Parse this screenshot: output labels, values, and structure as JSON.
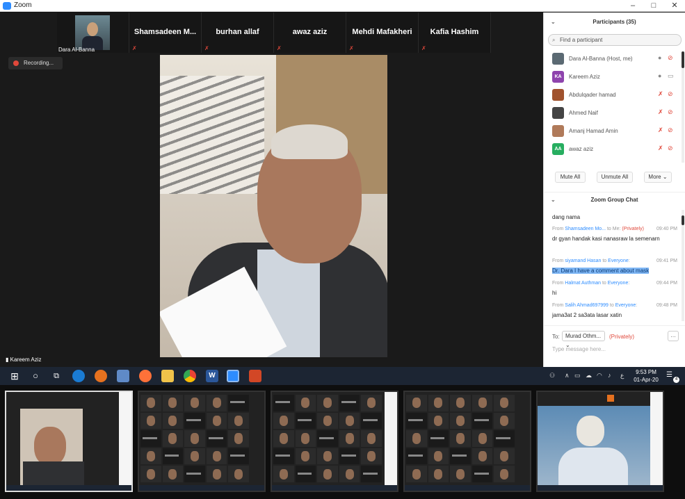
{
  "window": {
    "title": "Zoom",
    "minimize": "–",
    "maximize": "□",
    "close": "✕"
  },
  "strip": {
    "tiles": [
      {
        "label": "Dara Al-Banna",
        "photo": true
      },
      {
        "label": "Shamsadeen  M..."
      },
      {
        "label": "burhan allaf"
      },
      {
        "label": "awaz aziz"
      },
      {
        "label": "Mehdi Mafakheri"
      },
      {
        "label": "Kafia Hashim"
      }
    ],
    "next_glyph": "›"
  },
  "recording": {
    "label": "Recording..."
  },
  "speaker": {
    "name": "Kareem Aziz"
  },
  "panel": {
    "title": "Participants (35)",
    "search_placeholder": "Find a participant",
    "participants": [
      {
        "name": "Dara Al-Banna (Host, me)",
        "avatar_color": "#5b6a73",
        "initials": ""
      },
      {
        "name": "Kareem Aziz",
        "avatar_color": "#8e44ad",
        "initials": "KA"
      },
      {
        "name": "Abdulqader hamad",
        "avatar_color": "#a0522d",
        "initials": ""
      },
      {
        "name": "Ahmed Naif",
        "avatar_color": "#444",
        "initials": ""
      },
      {
        "name": "Amanj Hamad Amin",
        "avatar_color": "#b07a5a",
        "initials": ""
      },
      {
        "name": "awaz aziz",
        "avatar_color": "#27ae60",
        "initials": "AA"
      }
    ],
    "mute_all": "Mute All",
    "unmute_all": "Unmute All",
    "more": "More",
    "chat_title": "Zoom Group Chat",
    "messages": [
      {
        "text": "dang nama"
      },
      {
        "from": "Shamsadeen Mo...",
        "to": "Me",
        "privacy": "(Privately)",
        "time": "09:40 PM",
        "text": "dr gyan handak kasi nanasraw la semenarn"
      },
      {
        "from": "siyamand Hasan",
        "to": "Everyone",
        "time": "09:41 PM",
        "text": "Dr. Dara I have a comment about mask",
        "highlight": true
      },
      {
        "from": "Halmat Authman",
        "to": "Everyone",
        "time": "09:44 PM",
        "text": "hi"
      },
      {
        "from": "Salih Ahmad697999",
        "to": "Everyone",
        "time": "09:48 PM",
        "text": "jama3at 2 sa3ata lasar xatin"
      }
    ],
    "to_label": "To:",
    "to_value": "Murad Othm...",
    "to_privacy": "(Privately)",
    "type_placeholder": "Type message here..."
  },
  "taskbar": {
    "time": "9:53 PM",
    "date": "01-Apr-20",
    "notifications": "4",
    "lang": "ع"
  },
  "accent": "#2d8cff",
  "alert": "#e0483b"
}
